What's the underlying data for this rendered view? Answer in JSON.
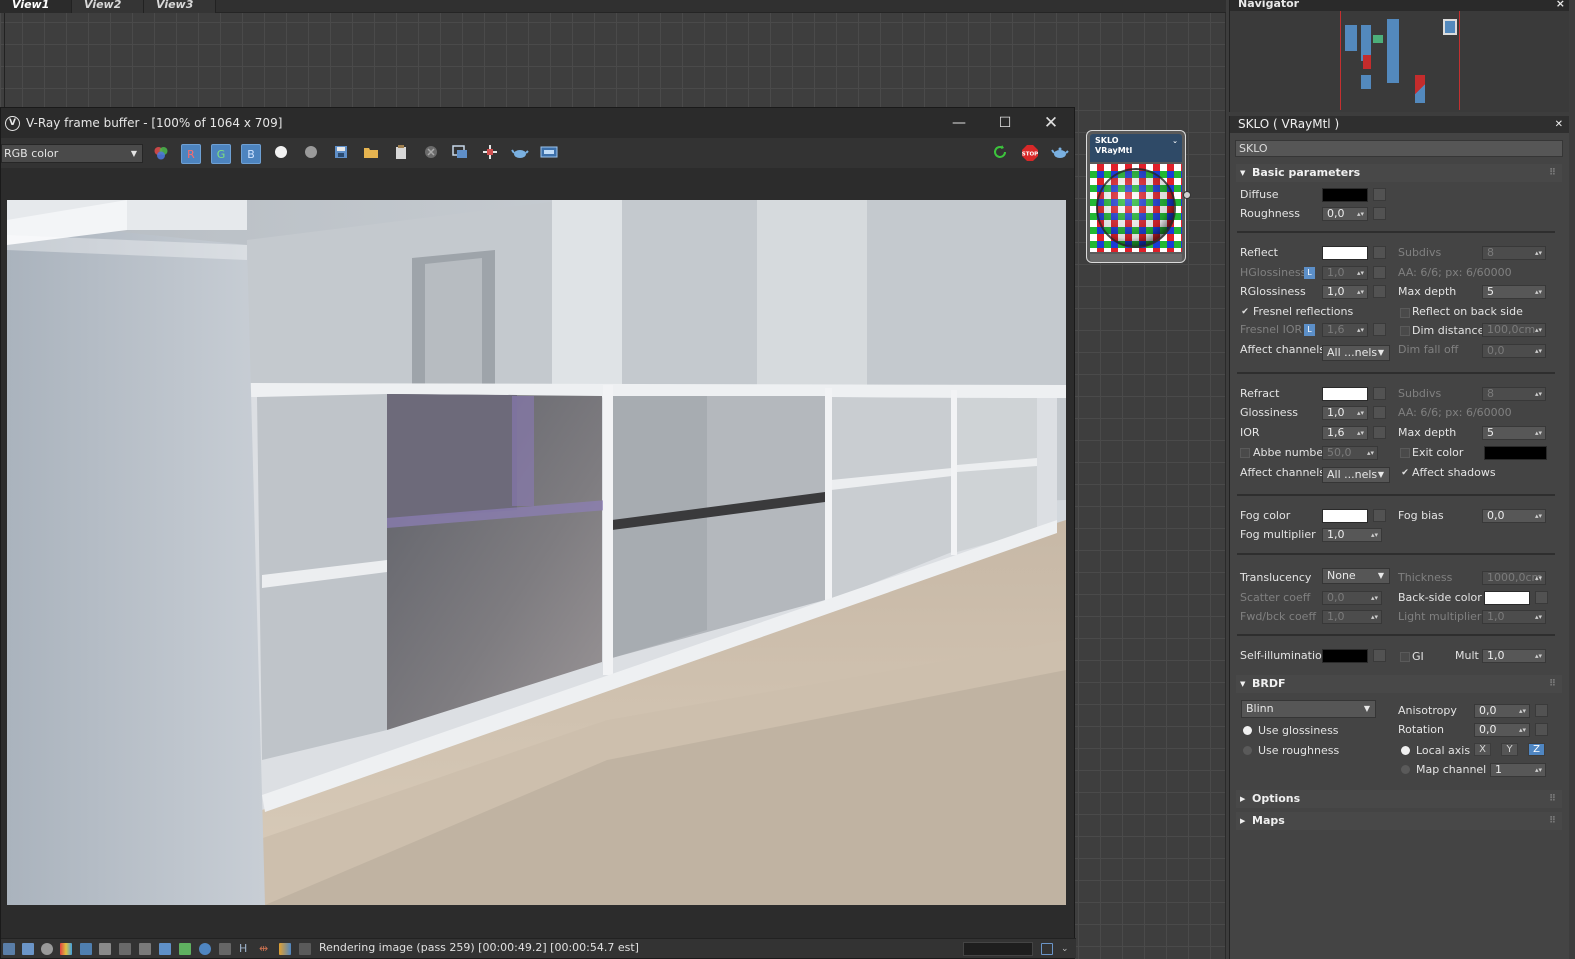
{
  "slate": {
    "tabs": [
      "View1",
      "View2",
      "View3"
    ],
    "node": {
      "name": "SKLO",
      "type": "VRayMtl"
    }
  },
  "vfb": {
    "title": "V-Ray frame buffer - [100% of 1064 x 709]",
    "channel": "RGB color",
    "channel_buttons": [
      "R",
      "G",
      "B"
    ],
    "status": "Rendering image (pass 259) [00:00:49.2] [00:00:54.7 est]",
    "stop_label": "STOP"
  },
  "navigator": {
    "title": "Navigator"
  },
  "material": {
    "title": "SKLO  ( VRayMtl )",
    "name": "SKLO",
    "rollouts": {
      "basic": "Basic parameters",
      "brdf": "BRDF",
      "options": "Options",
      "maps": "Maps"
    },
    "diffuse": {
      "label": "Diffuse",
      "color": "#000000"
    },
    "roughness": {
      "label": "Roughness",
      "value": "0,0"
    },
    "reflect": {
      "label": "Reflect",
      "color": "#ffffff",
      "subdivs_label": "Subdivs",
      "subdivs": "8",
      "hgloss_label": "HGlossiness",
      "hgloss": "1,0",
      "aa_text": "AA: 6/6; px: 6/60000",
      "rgloss_label": "RGlossiness",
      "rgloss": "1,0",
      "maxdepth_label": "Max depth",
      "maxdepth": "5",
      "fresnel_label": "Fresnel reflections",
      "backside_label": "Reflect on back side",
      "fresnel_ior_label": "Fresnel IOR",
      "fresnel_ior": "1,6",
      "dimdist_label": "Dim distance",
      "dimdist": "100,0cm",
      "affect_label": "Affect channels",
      "affect": "All ...nels",
      "dimfall_label": "Dim fall off",
      "dimfall": "0,0"
    },
    "refract": {
      "label": "Refract",
      "color": "#ffffff",
      "subdivs_label": "Subdivs",
      "subdivs": "8",
      "gloss_label": "Glossiness",
      "gloss": "1,0",
      "aa_text": "AA: 6/6; px: 6/60000",
      "ior_label": "IOR",
      "ior": "1,6",
      "maxdepth_label": "Max depth",
      "maxdepth": "5",
      "abbe_label": "Abbe number",
      "abbe": "50,0",
      "exit_label": "Exit color",
      "exit_color": "#000000",
      "affect_label": "Affect channels",
      "affect": "All ...nels",
      "shadows_label": "Affect shadows"
    },
    "fog": {
      "color_label": "Fog color",
      "color": "#ffffff",
      "bias_label": "Fog bias",
      "bias": "0,0",
      "mult_label": "Fog multiplier",
      "mult": "1,0"
    },
    "translucency": {
      "label": "Translucency",
      "value": "None",
      "thickness_label": "Thickness",
      "thickness": "1000,0cm",
      "scatter_label": "Scatter coeff",
      "scatter": "0,0",
      "backside_label": "Back-side color",
      "backside_color": "#ffffff",
      "fwd_label": "Fwd/bck coeff",
      "fwd": "1,0",
      "light_label": "Light multiplier",
      "light": "1,0"
    },
    "selfillum": {
      "label": "Self-illumination",
      "color": "#000000",
      "gi_label": "GI",
      "mult_label": "Mult",
      "mult": "1,0"
    },
    "brdf": {
      "type": "Blinn",
      "aniso_label": "Anisotropy",
      "aniso": "0,0",
      "rotation_label": "Rotation",
      "rotation": "0,0",
      "use_gloss": "Use glossiness",
      "use_rough": "Use roughness",
      "local_axis": "Local axis",
      "axes": [
        "X",
        "Y",
        "Z"
      ],
      "map_channel_label": "Map channel",
      "map_channel": "1"
    }
  }
}
